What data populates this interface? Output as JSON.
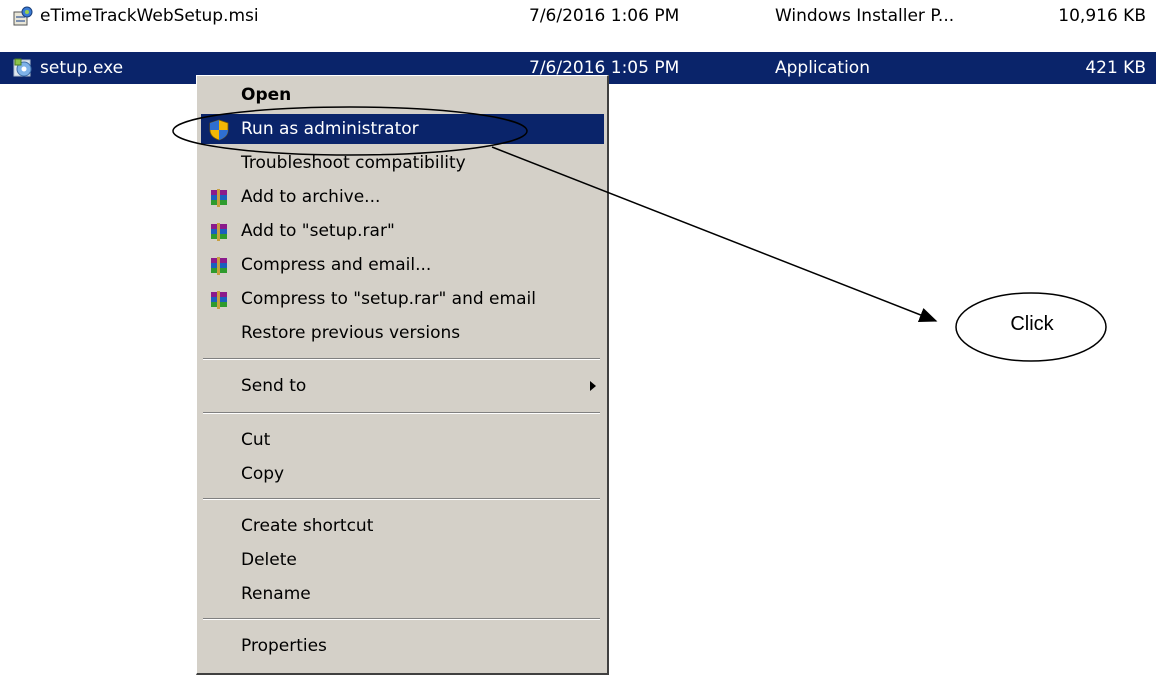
{
  "files": [
    {
      "name": "eTimeTrackWebSetup.msi",
      "date": "7/6/2016 1:06 PM",
      "type": "Windows Installer P...",
      "size": "10,916 KB",
      "icon": "msi-installer-icon",
      "selected": false
    },
    {
      "name": "setup.exe",
      "date": "7/6/2016 1:05 PM",
      "type": "Application",
      "size": "421 KB",
      "icon": "setup-exe-icon",
      "selected": true
    }
  ],
  "menu": {
    "items": [
      {
        "label": "Open",
        "icon": "",
        "bold": true
      },
      {
        "label": "Run as administrator",
        "icon": "uac-shield-icon",
        "selected": true
      },
      {
        "label": "Troubleshoot compatibility",
        "icon": ""
      },
      {
        "label": "Add to archive...",
        "icon": "winrar-icon"
      },
      {
        "label": "Add to \"setup.rar\"",
        "icon": "winrar-icon"
      },
      {
        "label": "Compress and email...",
        "icon": "winrar-icon"
      },
      {
        "label": "Compress to \"setup.rar\" and email",
        "icon": "winrar-icon"
      },
      {
        "label": "Restore previous versions",
        "icon": ""
      },
      {
        "label": "Send to",
        "icon": "",
        "submenu": true
      },
      {
        "label": "Cut",
        "icon": ""
      },
      {
        "label": "Copy",
        "icon": ""
      },
      {
        "label": "Create shortcut",
        "icon": ""
      },
      {
        "label": "Delete",
        "icon": ""
      },
      {
        "label": "Rename",
        "icon": ""
      },
      {
        "label": "Properties",
        "icon": ""
      }
    ]
  },
  "annotation": {
    "label": "Click"
  },
  "colors": {
    "selection": "#0a246a",
    "menu_bg": "#d4d0c8"
  }
}
